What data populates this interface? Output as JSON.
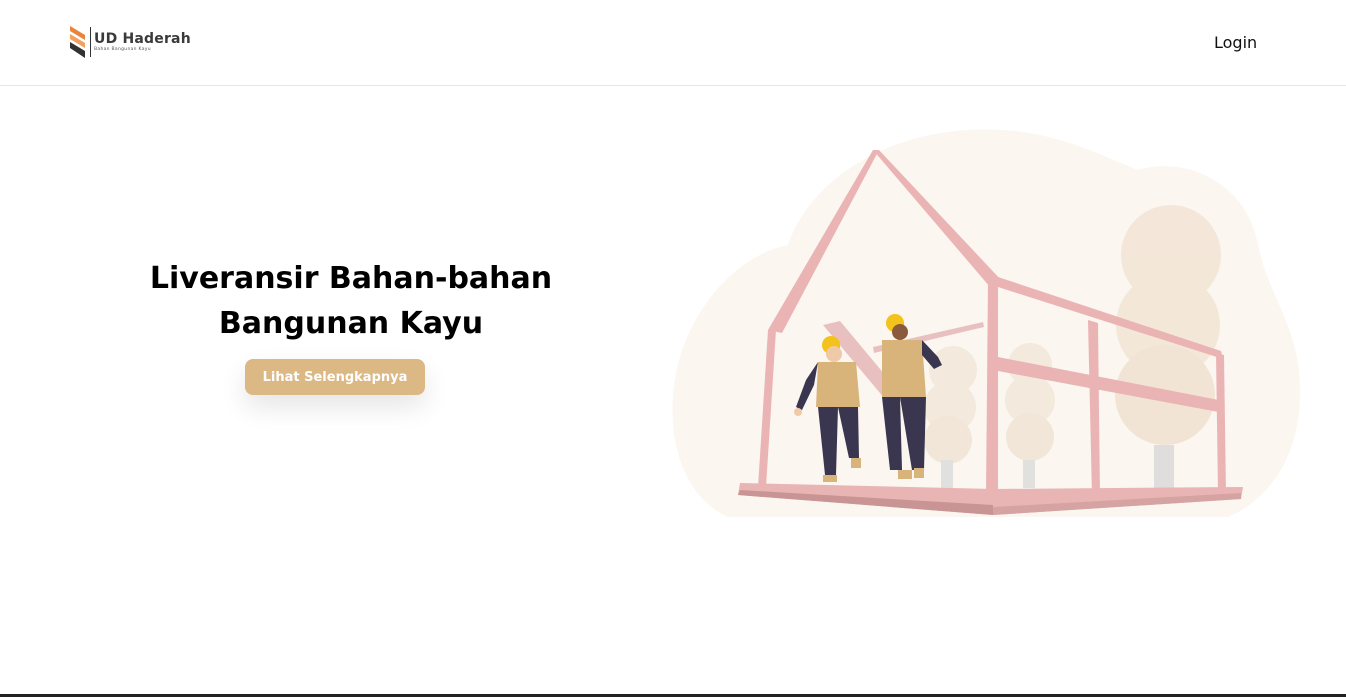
{
  "header": {
    "brand_name": "UD Haderah",
    "brand_tagline": "Bahan Bangunan Kayu",
    "login_label": "Login"
  },
  "hero": {
    "title_line1": "Liveransir Bahan-bahan",
    "title_line2": "Bangunan Kayu",
    "cta_label": "Lihat Selengkapnya"
  },
  "colors": {
    "accent": "#dcb884",
    "logo_orange": "#e8843c",
    "logo_dark": "#333333",
    "frame_pink": "#eab4b4",
    "background_cream": "#fbf6f0",
    "worker_vest": "#d9b47a",
    "worker_pants": "#3a3650",
    "helmet_yellow": "#f3c21b"
  }
}
